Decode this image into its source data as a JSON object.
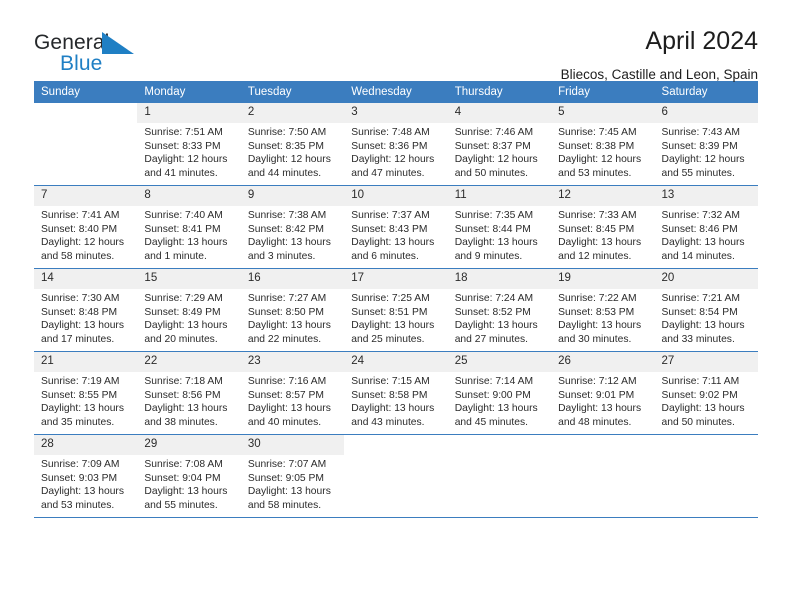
{
  "brand": {
    "name_part1": "General",
    "name_part2": "Blue",
    "logo_icon": "blue-triangle-flag-icon",
    "accent_color": "#1f7fc4"
  },
  "header": {
    "title": "April 2024",
    "subtitle": "Bliecos, Castille and Leon, Spain"
  },
  "theme": {
    "header_row_color": "#3b7dbf",
    "day_number_band_color": "#f0f0f0",
    "cell_background": "#ffffff",
    "text_color": "#2b2b2b"
  },
  "calendar": {
    "weekday_headers": [
      "Sunday",
      "Monday",
      "Tuesday",
      "Wednesday",
      "Thursday",
      "Friday",
      "Saturday"
    ],
    "weeks": [
      [
        {
          "empty": true
        },
        {
          "day": "1",
          "sunrise": "Sunrise: 7:51 AM",
          "sunset": "Sunset: 8:33 PM",
          "daylight_line1": "Daylight: 12 hours",
          "daylight_line2": "and 41 minutes."
        },
        {
          "day": "2",
          "sunrise": "Sunrise: 7:50 AM",
          "sunset": "Sunset: 8:35 PM",
          "daylight_line1": "Daylight: 12 hours",
          "daylight_line2": "and 44 minutes."
        },
        {
          "day": "3",
          "sunrise": "Sunrise: 7:48 AM",
          "sunset": "Sunset: 8:36 PM",
          "daylight_line1": "Daylight: 12 hours",
          "daylight_line2": "and 47 minutes."
        },
        {
          "day": "4",
          "sunrise": "Sunrise: 7:46 AM",
          "sunset": "Sunset: 8:37 PM",
          "daylight_line1": "Daylight: 12 hours",
          "daylight_line2": "and 50 minutes."
        },
        {
          "day": "5",
          "sunrise": "Sunrise: 7:45 AM",
          "sunset": "Sunset: 8:38 PM",
          "daylight_line1": "Daylight: 12 hours",
          "daylight_line2": "and 53 minutes."
        },
        {
          "day": "6",
          "sunrise": "Sunrise: 7:43 AM",
          "sunset": "Sunset: 8:39 PM",
          "daylight_line1": "Daylight: 12 hours",
          "daylight_line2": "and 55 minutes."
        }
      ],
      [
        {
          "day": "7",
          "sunrise": "Sunrise: 7:41 AM",
          "sunset": "Sunset: 8:40 PM",
          "daylight_line1": "Daylight: 12 hours",
          "daylight_line2": "and 58 minutes."
        },
        {
          "day": "8",
          "sunrise": "Sunrise: 7:40 AM",
          "sunset": "Sunset: 8:41 PM",
          "daylight_line1": "Daylight: 13 hours",
          "daylight_line2": "and 1 minute."
        },
        {
          "day": "9",
          "sunrise": "Sunrise: 7:38 AM",
          "sunset": "Sunset: 8:42 PM",
          "daylight_line1": "Daylight: 13 hours",
          "daylight_line2": "and 3 minutes."
        },
        {
          "day": "10",
          "sunrise": "Sunrise: 7:37 AM",
          "sunset": "Sunset: 8:43 PM",
          "daylight_line1": "Daylight: 13 hours",
          "daylight_line2": "and 6 minutes."
        },
        {
          "day": "11",
          "sunrise": "Sunrise: 7:35 AM",
          "sunset": "Sunset: 8:44 PM",
          "daylight_line1": "Daylight: 13 hours",
          "daylight_line2": "and 9 minutes."
        },
        {
          "day": "12",
          "sunrise": "Sunrise: 7:33 AM",
          "sunset": "Sunset: 8:45 PM",
          "daylight_line1": "Daylight: 13 hours",
          "daylight_line2": "and 12 minutes."
        },
        {
          "day": "13",
          "sunrise": "Sunrise: 7:32 AM",
          "sunset": "Sunset: 8:46 PM",
          "daylight_line1": "Daylight: 13 hours",
          "daylight_line2": "and 14 minutes."
        }
      ],
      [
        {
          "day": "14",
          "sunrise": "Sunrise: 7:30 AM",
          "sunset": "Sunset: 8:48 PM",
          "daylight_line1": "Daylight: 13 hours",
          "daylight_line2": "and 17 minutes."
        },
        {
          "day": "15",
          "sunrise": "Sunrise: 7:29 AM",
          "sunset": "Sunset: 8:49 PM",
          "daylight_line1": "Daylight: 13 hours",
          "daylight_line2": "and 20 minutes."
        },
        {
          "day": "16",
          "sunrise": "Sunrise: 7:27 AM",
          "sunset": "Sunset: 8:50 PM",
          "daylight_line1": "Daylight: 13 hours",
          "daylight_line2": "and 22 minutes."
        },
        {
          "day": "17",
          "sunrise": "Sunrise: 7:25 AM",
          "sunset": "Sunset: 8:51 PM",
          "daylight_line1": "Daylight: 13 hours",
          "daylight_line2": "and 25 minutes."
        },
        {
          "day": "18",
          "sunrise": "Sunrise: 7:24 AM",
          "sunset": "Sunset: 8:52 PM",
          "daylight_line1": "Daylight: 13 hours",
          "daylight_line2": "and 27 minutes."
        },
        {
          "day": "19",
          "sunrise": "Sunrise: 7:22 AM",
          "sunset": "Sunset: 8:53 PM",
          "daylight_line1": "Daylight: 13 hours",
          "daylight_line2": "and 30 minutes."
        },
        {
          "day": "20",
          "sunrise": "Sunrise: 7:21 AM",
          "sunset": "Sunset: 8:54 PM",
          "daylight_line1": "Daylight: 13 hours",
          "daylight_line2": "and 33 minutes."
        }
      ],
      [
        {
          "day": "21",
          "sunrise": "Sunrise: 7:19 AM",
          "sunset": "Sunset: 8:55 PM",
          "daylight_line1": "Daylight: 13 hours",
          "daylight_line2": "and 35 minutes."
        },
        {
          "day": "22",
          "sunrise": "Sunrise: 7:18 AM",
          "sunset": "Sunset: 8:56 PM",
          "daylight_line1": "Daylight: 13 hours",
          "daylight_line2": "and 38 minutes."
        },
        {
          "day": "23",
          "sunrise": "Sunrise: 7:16 AM",
          "sunset": "Sunset: 8:57 PM",
          "daylight_line1": "Daylight: 13 hours",
          "daylight_line2": "and 40 minutes."
        },
        {
          "day": "24",
          "sunrise": "Sunrise: 7:15 AM",
          "sunset": "Sunset: 8:58 PM",
          "daylight_line1": "Daylight: 13 hours",
          "daylight_line2": "and 43 minutes."
        },
        {
          "day": "25",
          "sunrise": "Sunrise: 7:14 AM",
          "sunset": "Sunset: 9:00 PM",
          "daylight_line1": "Daylight: 13 hours",
          "daylight_line2": "and 45 minutes."
        },
        {
          "day": "26",
          "sunrise": "Sunrise: 7:12 AM",
          "sunset": "Sunset: 9:01 PM",
          "daylight_line1": "Daylight: 13 hours",
          "daylight_line2": "and 48 minutes."
        },
        {
          "day": "27",
          "sunrise": "Sunrise: 7:11 AM",
          "sunset": "Sunset: 9:02 PM",
          "daylight_line1": "Daylight: 13 hours",
          "daylight_line2": "and 50 minutes."
        }
      ],
      [
        {
          "day": "28",
          "sunrise": "Sunrise: 7:09 AM",
          "sunset": "Sunset: 9:03 PM",
          "daylight_line1": "Daylight: 13 hours",
          "daylight_line2": "and 53 minutes."
        },
        {
          "day": "29",
          "sunrise": "Sunrise: 7:08 AM",
          "sunset": "Sunset: 9:04 PM",
          "daylight_line1": "Daylight: 13 hours",
          "daylight_line2": "and 55 minutes."
        },
        {
          "day": "30",
          "sunrise": "Sunrise: 7:07 AM",
          "sunset": "Sunset: 9:05 PM",
          "daylight_line1": "Daylight: 13 hours",
          "daylight_line2": "and 58 minutes."
        },
        {
          "empty": true
        },
        {
          "empty": true
        },
        {
          "empty": true
        },
        {
          "empty": true
        }
      ]
    ]
  }
}
